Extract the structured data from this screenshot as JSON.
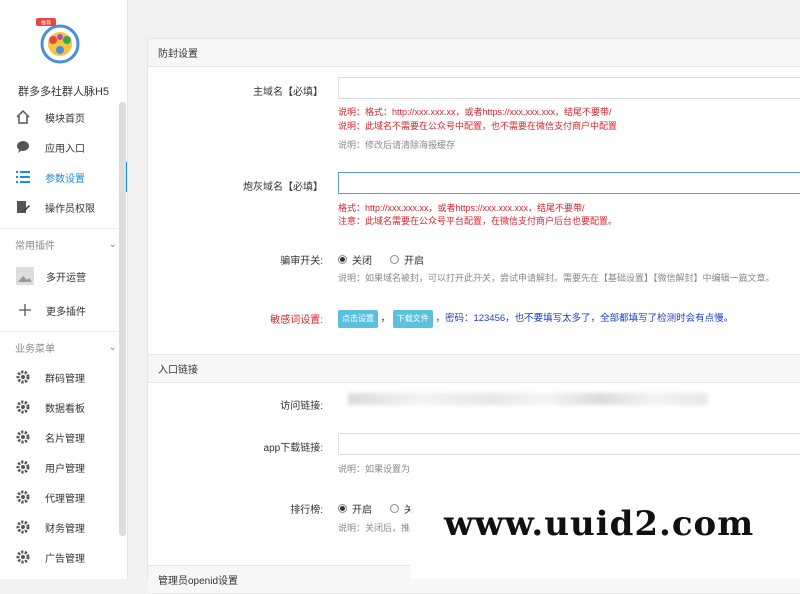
{
  "brand": {
    "name": "群多多社群人脉H5",
    "badge": "推荐"
  },
  "nav": [
    {
      "label": "模块首页",
      "icon": "home-icon"
    },
    {
      "label": "应用入口",
      "icon": "chat-bubble-icon"
    },
    {
      "label": "参数设置",
      "icon": "list-icon",
      "active": true
    },
    {
      "label": "操作员权限",
      "icon": "document-edit-icon"
    }
  ],
  "plugins": {
    "title": "常用插件",
    "items": [
      {
        "label": "多开运营",
        "icon": "image-icon"
      },
      {
        "label": "更多插件",
        "icon": "plus-icon"
      }
    ]
  },
  "business": {
    "title": "业务菜单",
    "items": [
      {
        "label": "群码管理",
        "icon": "gear-icon"
      },
      {
        "label": "数据看板",
        "icon": "gear-icon"
      },
      {
        "label": "名片管理",
        "icon": "gear-icon"
      },
      {
        "label": "用户管理",
        "icon": "gear-icon"
      },
      {
        "label": "代理管理",
        "icon": "gear-icon"
      },
      {
        "label": "财务管理",
        "icon": "gear-icon"
      },
      {
        "label": "广告管理",
        "icon": "gear-icon"
      }
    ]
  },
  "sections": {
    "anti_ban": "防封设置",
    "entry_links": "入口链接",
    "admin_openid": "管理员openid设置"
  },
  "form": {
    "main_domain": {
      "label": "主域名【必填】",
      "value": "",
      "note1": "说明：格式：http://xxx.xxx.xx，或者https://xxx.xxx.xxx，结尾不要带/",
      "note2": "说明：此域名不需要在公众号中配置，也不需要在微信支付商户中配置",
      "note3": "说明：修改后请清除海报缓存"
    },
    "cannon_domain": {
      "label": "炮灰域名【必填】",
      "value": "",
      "note1": "格式：http://xxx.xxx.xx，或者https://xxx.xxx.xxx，结尾不要带/",
      "note2": "注意：此域名需要在公众号平台配置，在微信支付商户后台也要配置。"
    },
    "review_switch": {
      "label": "骗审开关:",
      "off": "关闭",
      "on": "开启",
      "selected": "关闭",
      "note": "说明：如果域名被封，可以打开此开关，尝试申请解封。需要先在【基础设置】【微信解封】中编辑一篇文章。"
    },
    "sensitive_words": {
      "label": "敏感词设置:",
      "btn_click": "点击设置",
      "btn_download": "下载文件",
      "text": "，密码：123456，也不要填写太多了，全部都填写了检测时会有点慢。"
    },
    "visit_link": {
      "label": "访问链接:"
    },
    "app_download": {
      "label": "app下载链接:",
      "value": "",
      "note": "说明：如果设置为"
    },
    "ranking": {
      "label": "排行榜:",
      "on": "开启",
      "off": "关",
      "selected": "开启",
      "note": "说明：关闭后，推"
    }
  },
  "watermark": "www.uuid2.com"
}
